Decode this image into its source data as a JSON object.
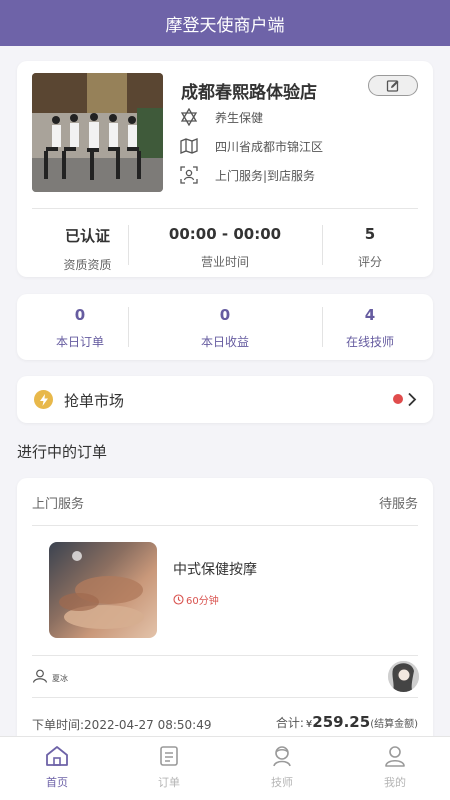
{
  "app": {
    "title": "摩登天使商户端"
  },
  "store": {
    "name": "成都春熙路体验店",
    "category": "养生保健",
    "address": "四川省成都市锦江区",
    "service_modes": "上门服务|到店服务",
    "stats": [
      {
        "value": "已认证",
        "label": "资质资质"
      },
      {
        "value": "00:00 - 00:00",
        "label": "营业时间"
      },
      {
        "value": "5",
        "label": "评分"
      }
    ]
  },
  "metrics": [
    {
      "value": "0",
      "label": "本日订单"
    },
    {
      "value": "0",
      "label": "本日收益"
    },
    {
      "value": "4",
      "label": "在线技师"
    }
  ],
  "market": {
    "label": "抢单市场"
  },
  "orders_section": {
    "title": "进行中的订单"
  },
  "order": {
    "type": "上门服务",
    "status": "待服务",
    "service_name": "中式保健按摩",
    "duration": "60分钟",
    "customer": "夏冰",
    "time_label": "下单时间:",
    "time_value": "2022-04-27 08:50:49",
    "total_label": "合计:",
    "currency": "¥",
    "amount": "259.25",
    "amount_note": "(结算金额)"
  },
  "nav": [
    {
      "label": "首页",
      "icon": "home-icon",
      "active": true
    },
    {
      "label": "订单",
      "icon": "order-icon",
      "active": false
    },
    {
      "label": "技师",
      "icon": "technician-icon",
      "active": false
    },
    {
      "label": "我的",
      "icon": "profile-icon",
      "active": false
    }
  ],
  "colors": {
    "primary": "#6e63a8",
    "accent": "#665ca0",
    "market_icon": "#e8b84a",
    "badge_dot": "#e04c4c",
    "duration": "#d9534f",
    "inactive_nav": "#b5b5b5"
  }
}
